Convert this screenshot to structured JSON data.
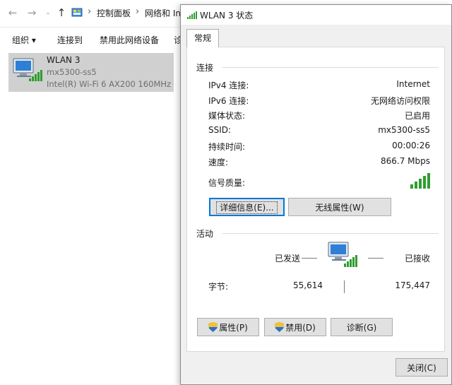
{
  "explorer": {
    "nav": {
      "back": "←",
      "forward": "→",
      "dropdown": "⌄",
      "up": "↑"
    },
    "breadcrumb": [
      "控制面板",
      "网络和 Int"
    ],
    "breadcrumb_sep": "›",
    "toolbar": {
      "organize": "组织 ▾",
      "connect": "连接到",
      "disable": "禁用此网络设备",
      "partial": "诊"
    },
    "adapter": {
      "name": "WLAN 3",
      "ssid": "mx5300-ss5",
      "device": "Intel(R) Wi-Fi 6 AX200 160MHz"
    }
  },
  "dialog": {
    "title": "WLAN 3 状态",
    "tab": "常规",
    "connection": {
      "heading": "连接",
      "rows": [
        {
          "label": "IPv4 连接:",
          "value": "Internet"
        },
        {
          "label": "IPv6 连接:",
          "value": "无网络访问权限"
        },
        {
          "label": "媒体状态:",
          "value": "已启用"
        },
        {
          "label": "SSID:",
          "value": "mx5300-ss5"
        },
        {
          "label": "持续时间:",
          "value": "00:00:26"
        },
        {
          "label": "速度:",
          "value": "866.7 Mbps"
        }
      ],
      "signal_label": "信号质量:",
      "signal_bars": 5,
      "details_button": "详细信息(E)...",
      "wireless_button": "无线属性(W)"
    },
    "activity": {
      "heading": "活动",
      "sent_label": "已发送",
      "received_label": "已接收",
      "bytes_label": "字节:",
      "bytes_sent": "55,614",
      "bytes_received": "175,447"
    },
    "buttons": {
      "properties": "属性(P)",
      "disable": "禁用(D)",
      "diagnose": "诊断(G)",
      "close": "关闭(C)"
    }
  },
  "colors": {
    "selection": "#d0d0d0",
    "signal_green": "#2e9e2e",
    "accent": "#0078d7"
  }
}
